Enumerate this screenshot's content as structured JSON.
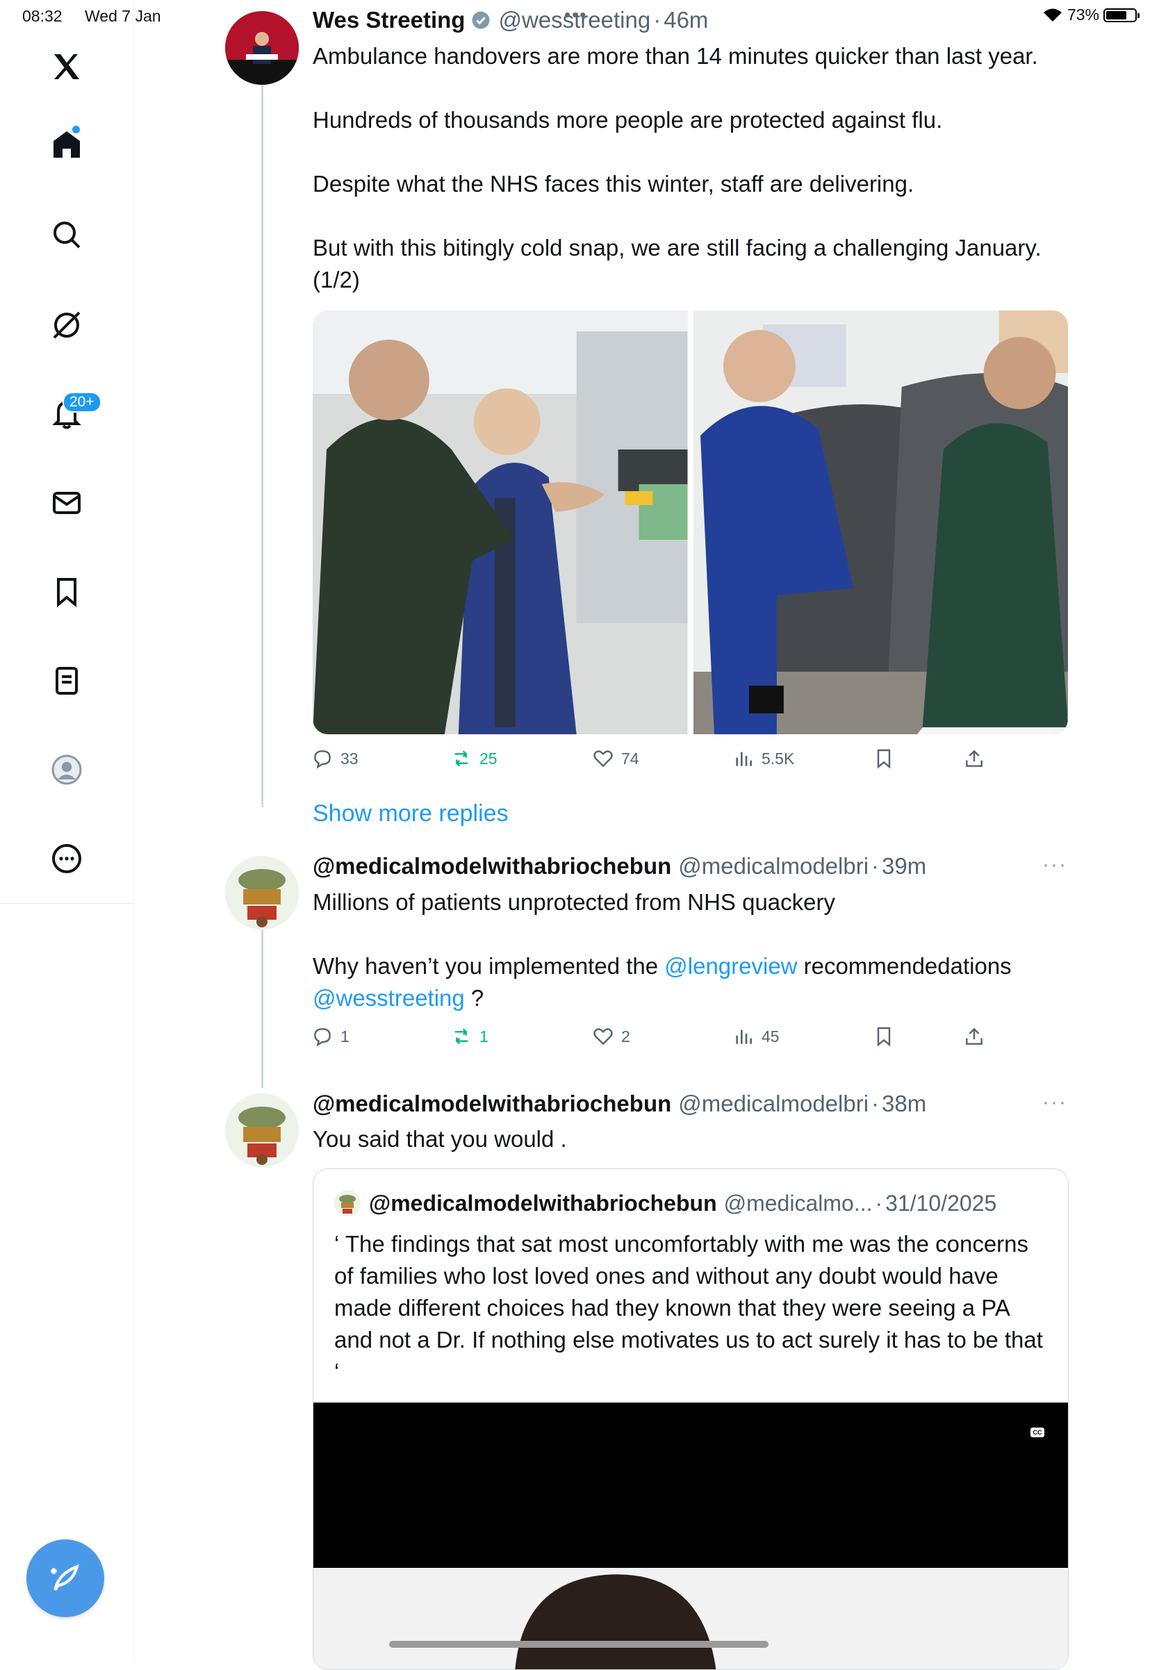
{
  "status_bar": {
    "time": "08:32",
    "date": "Wed 7 Jan",
    "battery": "73%",
    "battery_level": 0.73
  },
  "sidebar": {
    "items": [
      {
        "name": "x-logo"
      },
      {
        "name": "home"
      },
      {
        "name": "explore"
      },
      {
        "name": "grok"
      },
      {
        "name": "notifications"
      },
      {
        "name": "messages"
      },
      {
        "name": "bookmarks"
      },
      {
        "name": "lists"
      },
      {
        "name": "profile"
      },
      {
        "name": "more"
      }
    ],
    "notifications_badge": "20+"
  },
  "posts": [
    {
      "name": "Wes Streeting",
      "handle": "@wesstreeting",
      "dot": "·",
      "time": "46m",
      "text": "Ambulance handovers are more than 14 minutes quicker than last year.\n\nHundreds of thousands more people are protected against flu.\n\nDespite what the NHS faces this winter, staff are delivering.\n\nBut with this bitingly cold snap, we are still facing a challenging January.\n(1/2)",
      "stats": {
        "replies": "33",
        "reposts": "25",
        "likes": "74",
        "views": "5.5K"
      }
    },
    {
      "name": "@medicalmodelwithabriochebun",
      "handle": "@medicalmodelbri",
      "dot": "·",
      "time": "39m",
      "text_1": "Millions of patients unprotected from NHS quackery",
      "text_2a": "Why haven’t you implemented the ",
      "mention_1": "@lengreview",
      "text_2b": " recommendedations",
      "mention_2": "@wesstreeting",
      "text_2c": " ?",
      "stats": {
        "replies": "1",
        "reposts": "1",
        "likes": "2",
        "views": "45"
      }
    },
    {
      "name": "@medicalmodelwithabriochebun",
      "handle": "@medicalmodelbri",
      "dot": "·",
      "time": "38m",
      "text": "You said that you would .",
      "quote": {
        "name": "@medicalmodelwithabriochebun",
        "handle": "@medicalmo...",
        "dot": "·",
        "date": "31/10/2025",
        "text": "‘ The findings that sat most uncomfortably with me was the concerns of families who lost loved ones and without any doubt would have made different choices had they known that they were seeing a PA and not a Dr. If nothing else motivates us to act surely it has to be that ‘",
        "cc_label": "CC"
      }
    }
  ],
  "show_more": "Show more replies",
  "more_dots": "···",
  "colors": {
    "accent": "#1d9bf0",
    "repost_green": "#00ba7c",
    "muted": "#536471"
  }
}
